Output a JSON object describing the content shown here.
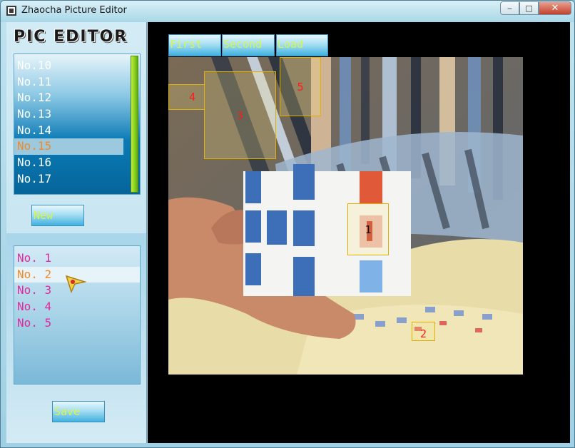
{
  "window": {
    "title": "Zhaocha Picture Editor"
  },
  "titlebar": {
    "minimize_glyph": "‒",
    "maximize_glyph": "□",
    "close_glyph": "✕"
  },
  "left_panel": {
    "logo": "PIC EDITOR",
    "picture_list": {
      "items": [
        "No.10",
        "No.11",
        "No.12",
        "No.13",
        "No.14",
        "No.15",
        "No.16",
        "No.17"
      ],
      "selected": "No.15"
    },
    "new_button": "New",
    "area_list": {
      "items": [
        "No. 1",
        "No. 2",
        "No. 3",
        "No. 4",
        "No. 5"
      ],
      "selected": "No. 2"
    },
    "save_button": "Save"
  },
  "toolbar": {
    "first": "First",
    "second": "Second",
    "load": "Load"
  },
  "image": {
    "subject": "hand holding Rubik's cube on striped pillow",
    "regions": [
      {
        "label": "1"
      },
      {
        "label": "2"
      },
      {
        "label": "3"
      },
      {
        "label": "4"
      },
      {
        "label": "5"
      }
    ]
  },
  "colors": {
    "button_text": "#d6f74a",
    "selected_text": "#f38a24",
    "area_text": "#e1289c",
    "region_border": "#e0b000",
    "region_label": "#ff1a1a",
    "list_dark": "#0a7ab5"
  },
  "icons": {
    "app": "window-app-icon",
    "cursor": "pointer-cursor-icon"
  }
}
